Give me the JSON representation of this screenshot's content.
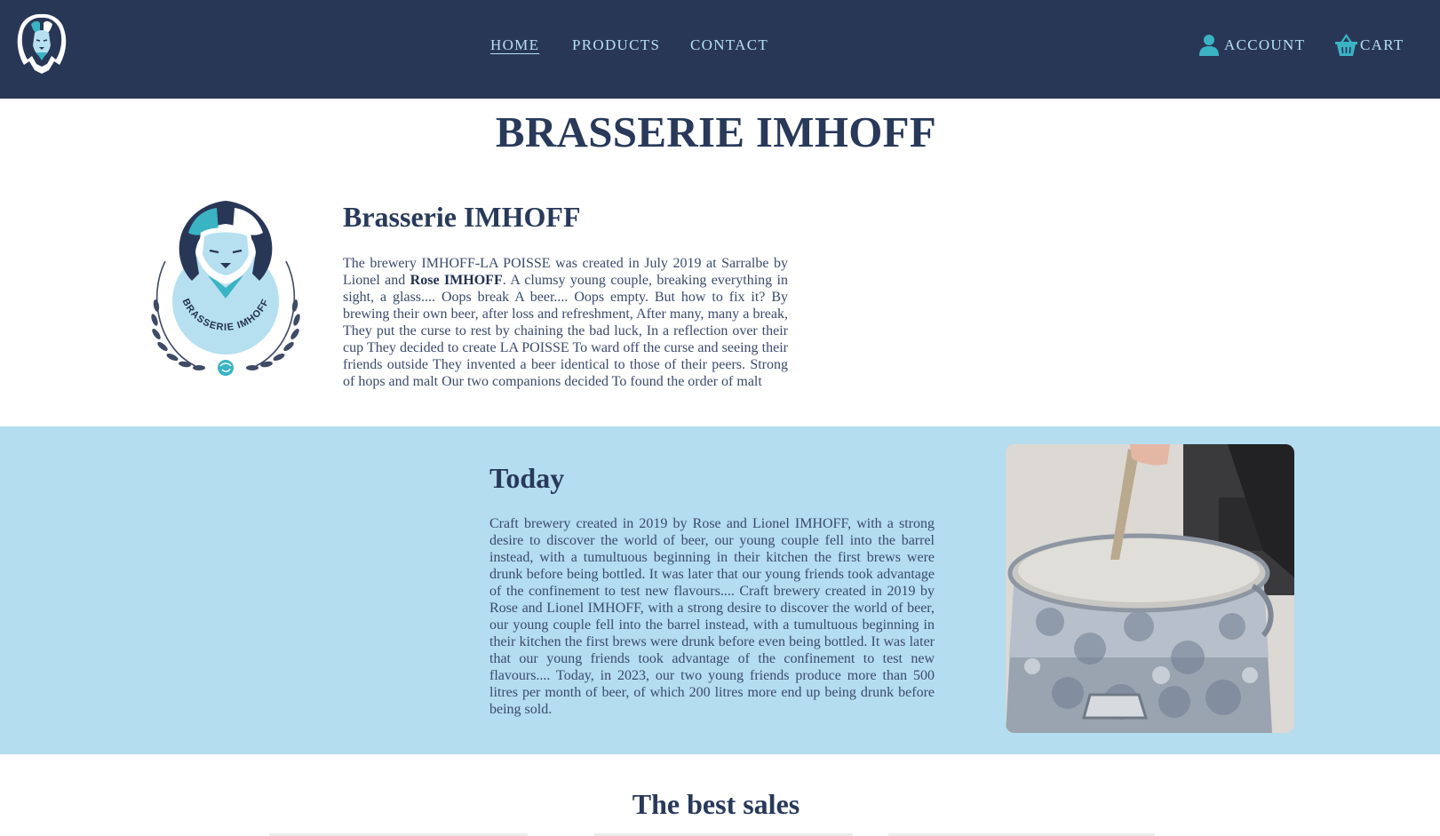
{
  "header": {
    "logo_icon": "lion-logo-icon",
    "nav": [
      {
        "label": "HOME",
        "active": true
      },
      {
        "label": "PRODUCTS",
        "active": false
      },
      {
        "label": "CONTACT",
        "active": false
      }
    ],
    "account": {
      "label": "ACCOUNT",
      "icon": "user-icon"
    },
    "cart": {
      "label": "CART",
      "icon": "basket-icon"
    }
  },
  "page_title": "BRASSERIE IMHOFF",
  "about": {
    "logo_icon": "brasserie-imhoff-emblem-icon",
    "logo_text": "BRASSERIE IMHOFF",
    "heading": "Brasserie IMHOFF",
    "text_before": "The brewery IMHOFF-LA POISSE was created in July 2019 at Sarralbe by Lionel and ",
    "text_bold": "Rose IMHOFF",
    "text_after": ". A clumsy young couple, breaking everything in sight, a glass.... Oops break A beer.... Oops empty. But how to fix it? By brewing their own beer, after loss and refreshment, After many, many a break, They put the curse to rest by chaining the bad luck, In a reflection over their cup They decided to create LA POISSE To ward off the curse and seeing their friends outside They invented a beer identical to those of their peers. Strong of hops and malt Our two companions decided To found the order of malt"
  },
  "today": {
    "heading": "Today",
    "text": "Craft brewery created in 2019 by Rose and Lionel IMHOFF, with a strong desire to discover the world of beer, our young couple fell into the barrel instead, with a tumultuous beginning in their kitchen the first brews were drunk before being bottled. It was later that our young friends took advantage of the confinement to test new flavours.... Craft brewery created in 2019 by Rose and Lionel IMHOFF, with a strong desire to discover the world of beer, our young couple fell into the barrel instead, with a tumultuous beginning in their kitchen the first brews were drunk before even being bottled. It was later that our young friends took advantage of the confinement to test new flavours.... Today, in 2023, our two young friends produce more than 500 litres per month of beer, of which 200 litres more end up being drunk before being sold.",
    "photo_icon": "brewing-kettle-photo"
  },
  "best_sales": {
    "heading": "The best sales"
  },
  "colors": {
    "header_bg": "#293757",
    "nav_text": "#b6e0f0",
    "accent_teal": "#3ab3c3",
    "band_bg": "#b4ddef",
    "heading_text": "#28395a"
  }
}
